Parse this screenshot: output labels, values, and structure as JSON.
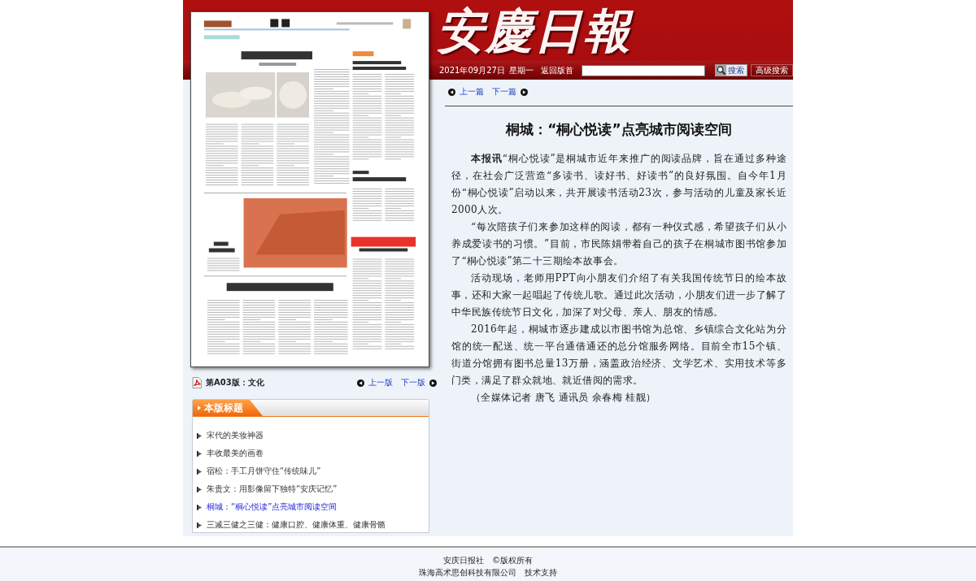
{
  "header": {
    "logo": "安慶日報",
    "date": "2021年09月27日",
    "weekday": "星期一",
    "home_link": "返回版首",
    "search_button": "搜索",
    "advanced_search_button": "高级搜索"
  },
  "edition_nav": {
    "edition": "第A03版：文化",
    "prev": "上一版",
    "next": "下一版"
  },
  "headlines_panel": {
    "title": "本版标题",
    "items": [
      {
        "label": "宋代的美妆神器",
        "selected": false
      },
      {
        "label": "丰收最美的画卷",
        "selected": false
      },
      {
        "label": "宿松：手工月饼守住“传统味儿”",
        "selected": false
      },
      {
        "label": "朱贵文：用影像留下独特“安庆记忆”",
        "selected": false
      },
      {
        "label": "桐城：“桐心悦读”点亮城市阅读空间",
        "selected": true
      },
      {
        "label": "三减三健之三健：健康口腔、健康体重、健康骨骼",
        "selected": false
      }
    ]
  },
  "article_nav": {
    "prev": "上一篇",
    "next": "下一篇"
  },
  "article": {
    "title": "桐城：“桐心悦读”点亮城市阅读空间",
    "paragraphs": [
      "**本报讯**“桐心悦读”是桐城市近年来推广的阅读品牌，旨在通过多种途径，在社会广泛营造“多读书、读好书、好读书”的良好氛围。自今年1月份“桐心悦读”启动以来，共开展读书活动23次，参与活动的儿童及家长近2000人次。",
      "“每次陪孩子们来参加这样的阅读，都有一种仪式感，希望孩子们从小养成爱读书的习惯。”目前，市民陈娟带着自己的孩子在桐城市图书馆参加了“桐心悦读”第二十三期绘本故事会。",
      "活动现场，老师用PPT向小朋友们介绍了有关我国传统节日的绘本故事，还和大家一起唱起了传统儿歌。通过此次活动，小朋友们进一步了解了中华民族传统节日文化，加深了对父母、亲人、朋友的情感。",
      "2016年起，桐城市逐步建成以市图书馆为总馆、乡镇综合文化站为分馆的统一配送、统一平台通借通还的总分馆服务网络。目前全市15个镇、街道分馆拥有图书总量13万册，涵盖政治经济、文学艺术、实用技术等多门类，满足了群众就地、就近借阅的需求。"
    ],
    "byline": "（全媒体记者 唐飞 通讯员 余春梅 桂靓）"
  },
  "footer": {
    "lines": [
      [
        "安庆日报社",
        "©版权所有"
      ],
      [
        "珠海高术思创科技有限公司",
        "技术支持"
      ]
    ]
  }
}
